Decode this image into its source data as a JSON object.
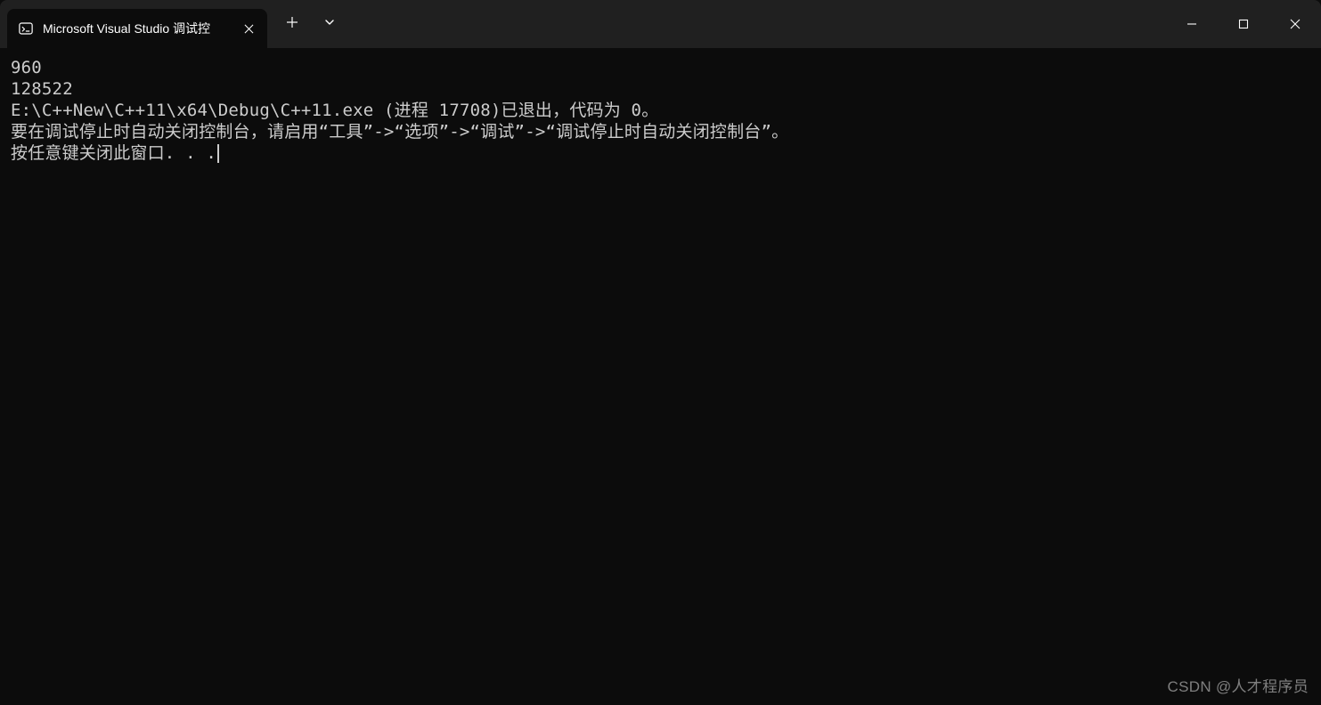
{
  "titlebar": {
    "tab_title": "Microsoft Visual Studio 调试控",
    "tab_icon_name": "terminal-icon",
    "new_tab_label": "+",
    "dropdown_label": "v"
  },
  "window_controls": {
    "minimize": "minimize",
    "maximize": "maximize",
    "close": "close"
  },
  "console": {
    "lines": {
      "l0": "960",
      "l1": "128522",
      "l2": "",
      "l3": "E:\\C++New\\C++11\\x64\\Debug\\C++11.exe (进程 17708)已退出，代码为 0。",
      "l4": "要在调试停止时自动关闭控制台，请启用“工具”->“选项”->“调试”->“调试停止时自动关闭控制台”。",
      "l5": "按任意键关闭此窗口. . ."
    }
  },
  "watermark": "CSDN @人才程序员"
}
